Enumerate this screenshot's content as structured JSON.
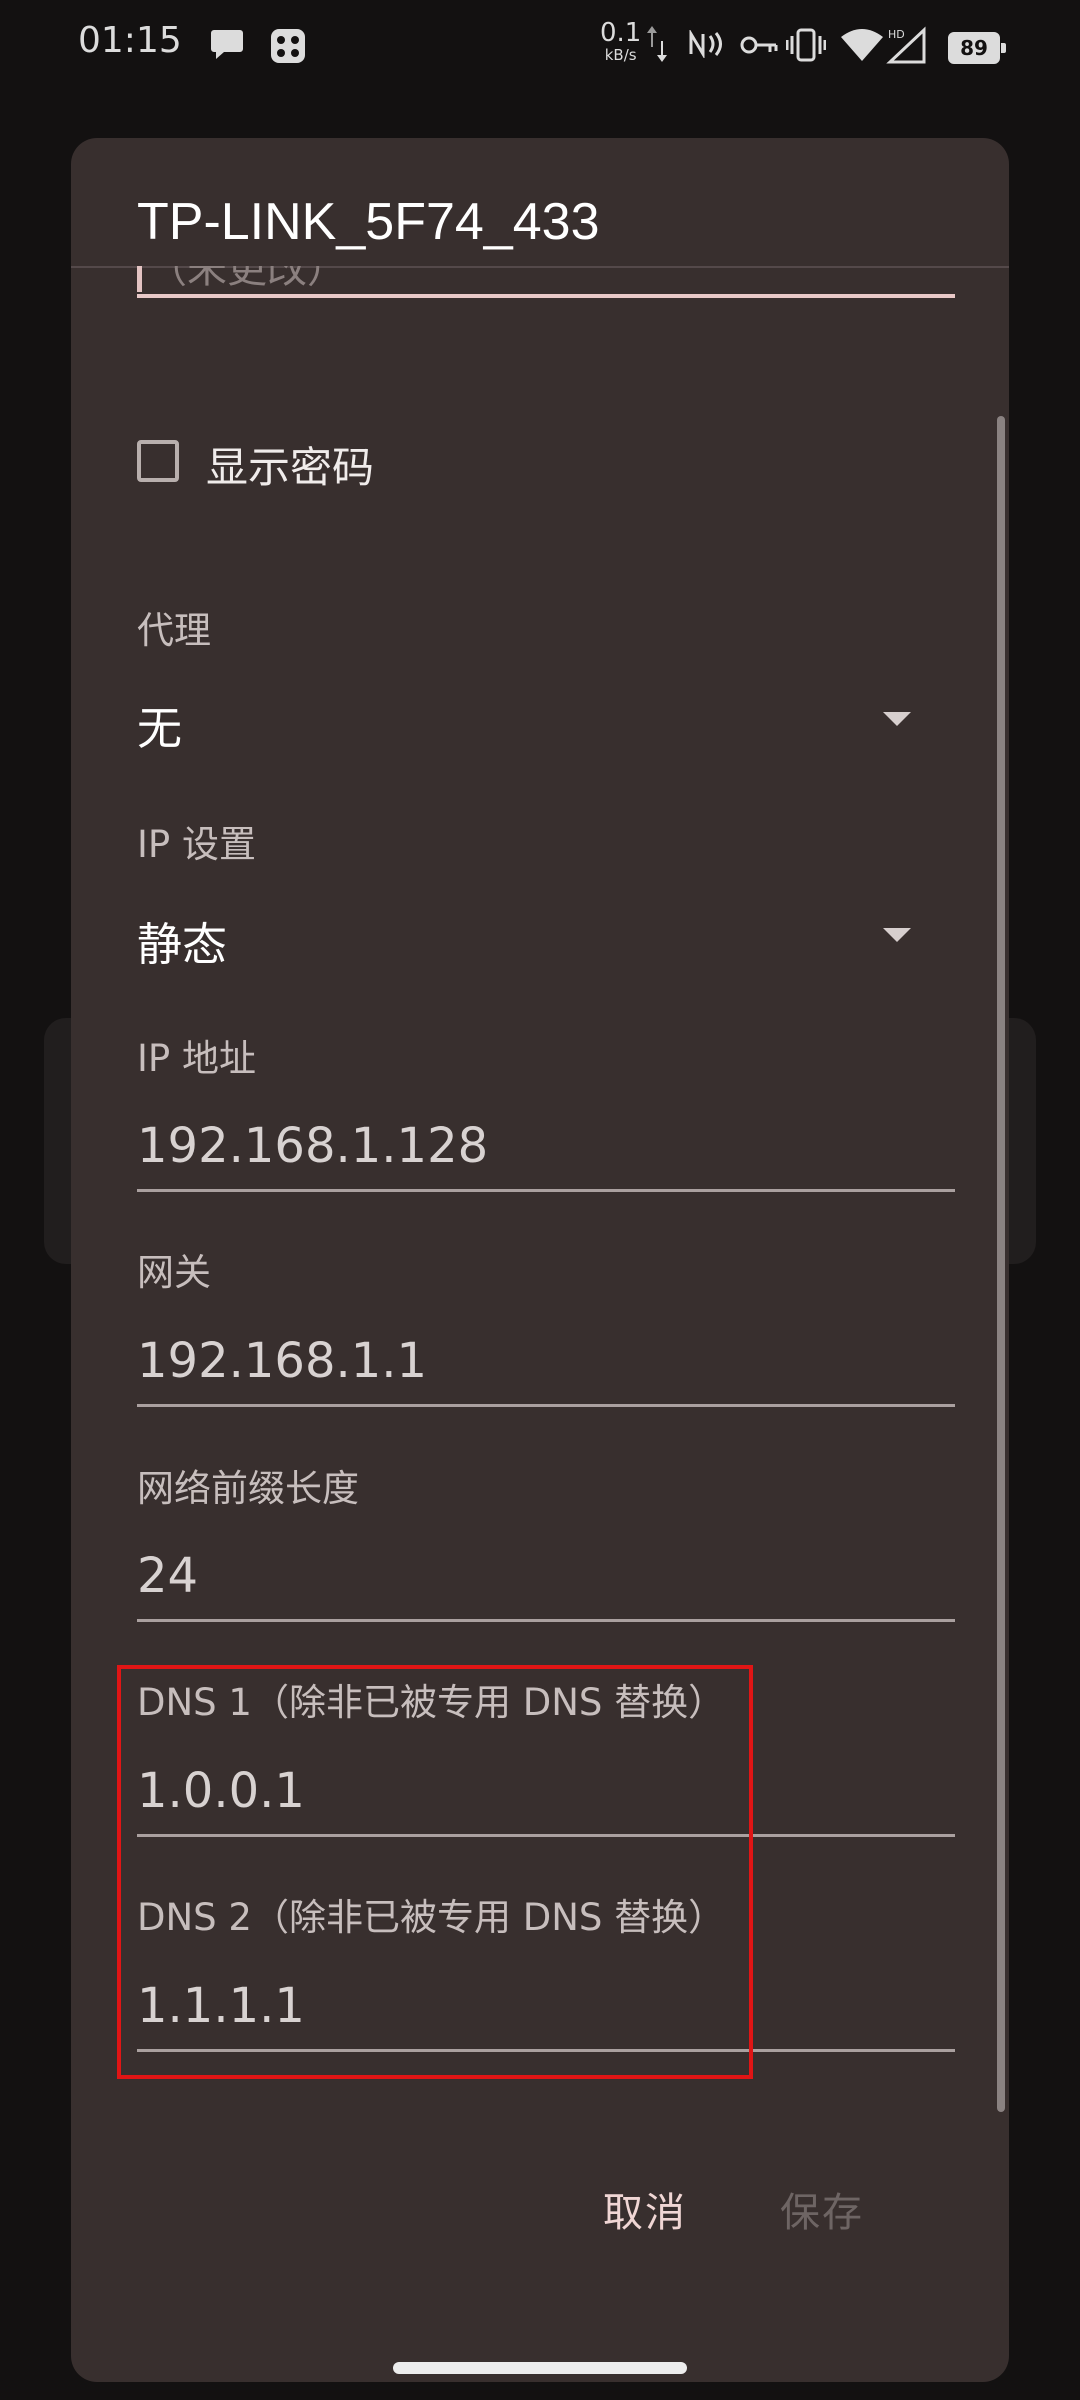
{
  "status_bar": {
    "time": "01:15",
    "net_speed": "0.1",
    "net_speed_unit": "kB/s",
    "battery": "89",
    "icons": [
      "chat-bubble-icon",
      "app-badge-icon",
      "updown-arrows-icon",
      "nfc-icon",
      "key-icon",
      "vibrate-icon",
      "wifi-icon",
      "signal-hd-icon",
      "battery-icon"
    ]
  },
  "dialog": {
    "title": "TP-LINK_5F74_433",
    "password_placeholder": "（未更改）",
    "show_password_label": "显示密码",
    "show_password_checked": false,
    "proxy": {
      "label": "代理",
      "value": "无"
    },
    "ip_settings": {
      "label": "IP 设置",
      "value": "静态"
    },
    "ip_address": {
      "label": "IP 地址",
      "value": "192.168.1.128"
    },
    "gateway": {
      "label": "网关",
      "value": "192.168.1.1"
    },
    "prefix_length": {
      "label": "网络前缀长度",
      "value": "24"
    },
    "dns1": {
      "label": "DNS 1（除非已被专用 DNS 替换）",
      "value": "1.0.0.1"
    },
    "dns2": {
      "label": "DNS 2（除非已被专用 DNS 替换）",
      "value": "1.1.1.1"
    },
    "cancel_label": "取消",
    "save_label": "保存"
  },
  "colors": {
    "dialog_bg": "#382f2e",
    "accent": "#f0d6d4",
    "highlight_box": "#e01515",
    "disabled": "#6e6564"
  }
}
